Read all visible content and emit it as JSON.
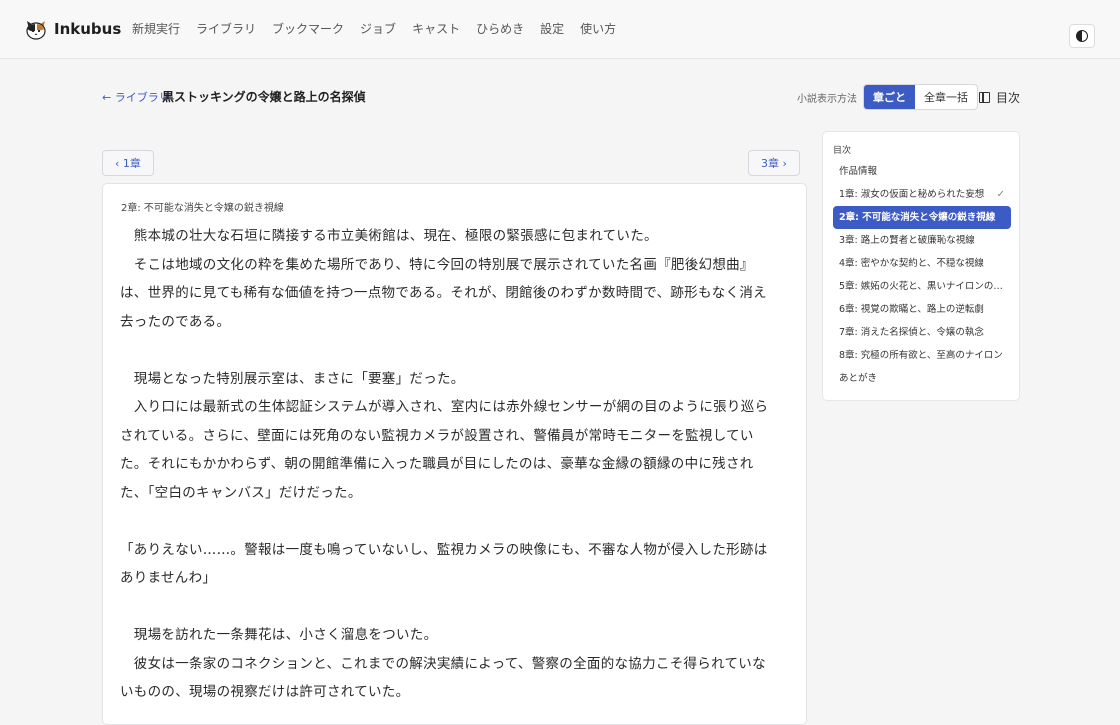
{
  "app": {
    "name": "Inkubus"
  },
  "nav": [
    "新規実行",
    "ライブラリ",
    "ブックマーク",
    "ジョブ",
    "キャスト",
    "ひらめき",
    "設定",
    "使い方"
  ],
  "title_row": {
    "back_label": "← ライブラリ",
    "title": "黒ストッキングの令嬢と路上の名探偵",
    "mode_label": "小説表示方法",
    "mode_options": [
      "章ごと",
      "全章一括"
    ],
    "toc_toggle": "目次"
  },
  "chapter_nav": {
    "prev": "‹  1章",
    "next": "3章  ›"
  },
  "chapter": {
    "label": "2章: 不可能な消失と令嬢の鋭き視線",
    "lines": [
      "　熊本城の壮大な石垣に隣接する市立美術館は、現在、極限の緊張感に包まれていた。",
      "　そこは地域の文化の粋を集めた場所であり、特に今回の特別展で展示されていた名画『肥後幻想曲』",
      "は、世界的に見ても稀有な価値を持つ一点物である。それが、閉館後のわずか数時間で、跡形もなく消え",
      "去ったのである。",
      "",
      "　現場となった特別展示室は、まさに「要塞」だった。",
      "　入り口には最新式の生体認証システムが導入され、室内には赤外線センサーが網の目のように張り巡ら",
      "されている。さらに、壁面には死角のない監視カメラが設置され、警備員が常時モニターを監視してい",
      "た。それにもかかわらず、朝の開館準備に入った職員が目にしたのは、豪華な金縁の額縁の中に残され",
      "た、「空白のキャンバス」だけだった。",
      "",
      "「ありえない……。警報は一度も鳴っていないし、監視カメラの映像にも、不審な人物が侵入した形跡は",
      "ありませんわ」",
      "",
      "　現場を訪れた一条舞花は、小さく溜息をついた。",
      "　彼女は一条家のコネクションと、これまでの解決実績によって、警察の全面的な協力こそ得られていな",
      "いものの、現場の視察だけは許可されていた。"
    ]
  },
  "toc": {
    "title": "目次",
    "items": [
      "作品情報",
      "1章: 淑女の仮面と秘められた妄想",
      "2章: 不可能な消失と令嬢の鋭き視線",
      "3章: 路上の賢者と破廉恥な視線",
      "4章: 密やかな契約と、不穏な視線",
      "5章: 嫉妬の火花と、黒いナイロンの…",
      "6章: 視覚の欺瞞と、路上の逆転劇",
      "7章: 消えた名探偵と、令嬢の執念",
      "8章: 究極の所有欲と、至高のナイロン",
      "あとがき"
    ],
    "active_index": 2,
    "checked_index": 1
  },
  "colors": {
    "accent": "#3d5bc4"
  }
}
